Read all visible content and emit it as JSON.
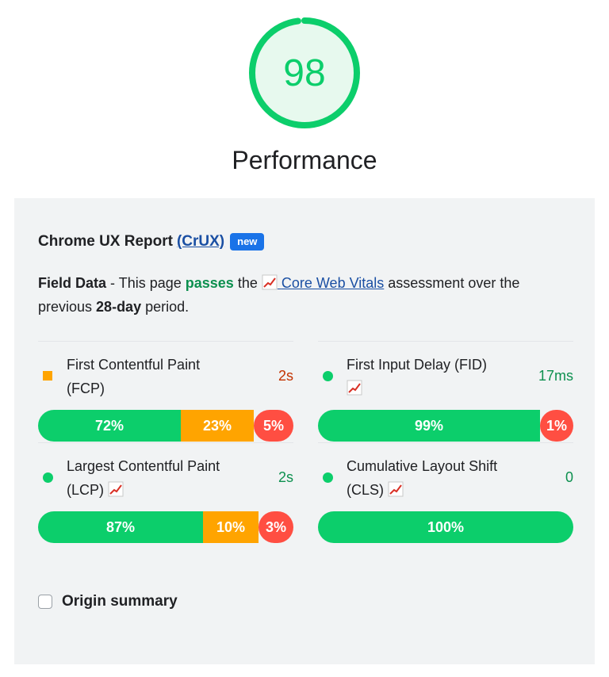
{
  "score": {
    "value": "98",
    "label": "Performance",
    "fraction": 0.98,
    "color": "#0cce6b"
  },
  "crux": {
    "title": "Chrome UX Report",
    "link_text": "(CrUX)",
    "badge": "new"
  },
  "field_data": {
    "lead": "Field Data",
    "sep": " - This page ",
    "status": "passes",
    "mid": " the ",
    "link_text": "Core Web Vitals",
    "mid2": " assessment over the previous ",
    "period": "28-day",
    "end": " period."
  },
  "metrics": [
    {
      "name": "First Contentful Paint (FCP)",
      "value": "2s",
      "marker": "average-square",
      "core_vital": false,
      "distribution": {
        "good": "72%",
        "average": "23%",
        "poor": "5%"
      },
      "fractions": {
        "good": 0.72,
        "average": 0.23,
        "poor": 0.05
      }
    },
    {
      "name": "First Input Delay (FID)",
      "value": "17ms",
      "marker": "good-circle",
      "core_vital": true,
      "distribution": {
        "good": "99%",
        "poor": "1%"
      },
      "fractions": {
        "good": 0.99,
        "poor": 0.01
      }
    },
    {
      "name": "Largest Contentful Paint (LCP)",
      "value": "2s",
      "marker": "good-circle",
      "core_vital": true,
      "distribution": {
        "good": "87%",
        "average": "10%",
        "poor": "3%"
      },
      "fractions": {
        "good": 0.87,
        "average": 0.1,
        "poor": 0.03
      }
    },
    {
      "name": "Cumulative Layout Shift (CLS)",
      "value": "0",
      "marker": "good-circle",
      "core_vital": true,
      "distribution": {
        "good": "100%"
      },
      "fractions": {
        "good": 1.0
      }
    }
  ],
  "origin_summary": {
    "label": "Origin summary",
    "checked": false
  },
  "colors": {
    "good": "#0cce6b",
    "average": "#ffa400",
    "poor": "#ff4e42",
    "link": "#1a4fa3",
    "badge": "#1a73e8"
  }
}
